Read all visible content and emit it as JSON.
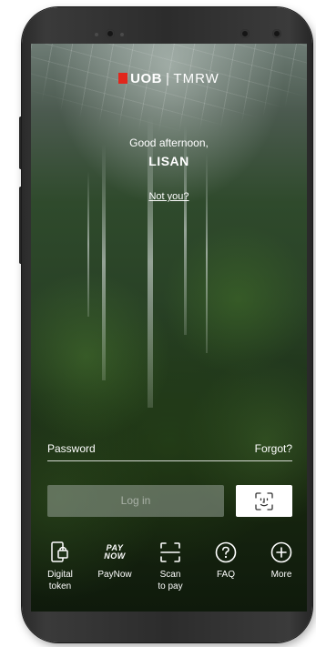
{
  "brand": {
    "logo_left": "UOB",
    "logo_sep": "|",
    "logo_right": "TMRW",
    "accent": "#e1261c"
  },
  "greeting": {
    "text": "Good afternoon,",
    "name": "LISAN",
    "not_you": "Not you?"
  },
  "login": {
    "password_label": "Password",
    "forgot_label": "Forgot?",
    "login_button": "Log in",
    "face_icon": "face-id-icon"
  },
  "quick_actions": [
    {
      "line1": "Digital",
      "line2": "token",
      "icon": "digital-token-icon"
    },
    {
      "line1": "PayNow",
      "line2": "",
      "icon": "paynow-icon",
      "icon_text1": "PAY",
      "icon_text2": "NOW"
    },
    {
      "line1": "Scan",
      "line2": "to pay",
      "icon": "scan-icon"
    },
    {
      "line1": "FAQ",
      "line2": "",
      "icon": "faq-icon"
    },
    {
      "line1": "More",
      "line2": "",
      "icon": "more-icon"
    }
  ]
}
